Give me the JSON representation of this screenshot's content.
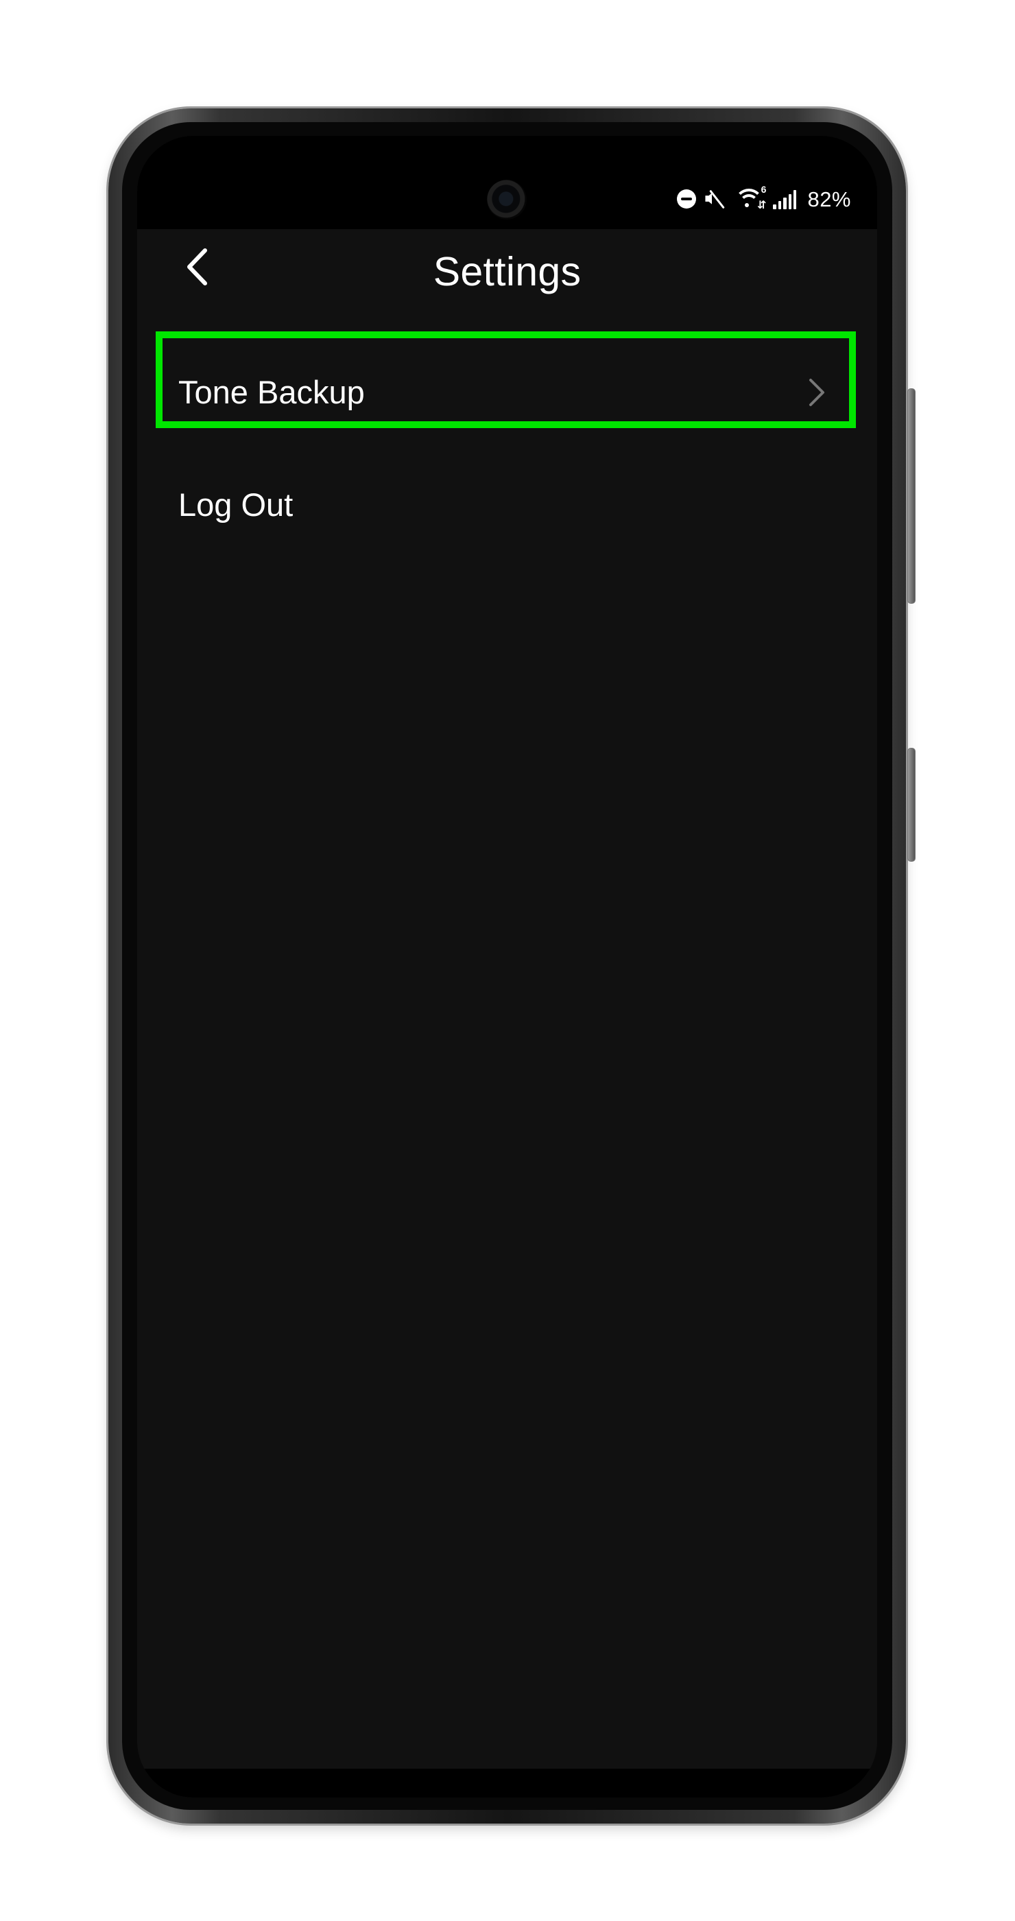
{
  "status_bar": {
    "icons": [
      "do-not-disturb-icon",
      "mute-icon",
      "wifi-6-icon",
      "signal-icon"
    ],
    "wifi_label": "6",
    "wifi_arrows": "⇵",
    "battery": "82%"
  },
  "app_bar": {
    "title": "Settings",
    "back_icon": "back-icon"
  },
  "settings": {
    "items": [
      {
        "label": "Tone Backup",
        "chevron": "chevron-right-icon",
        "highlighted": true
      },
      {
        "label": "Log Out"
      }
    ]
  },
  "theme": {
    "background": "#111111",
    "text": "#ffffff",
    "highlight": "#00e600",
    "chevron": "#777777"
  }
}
